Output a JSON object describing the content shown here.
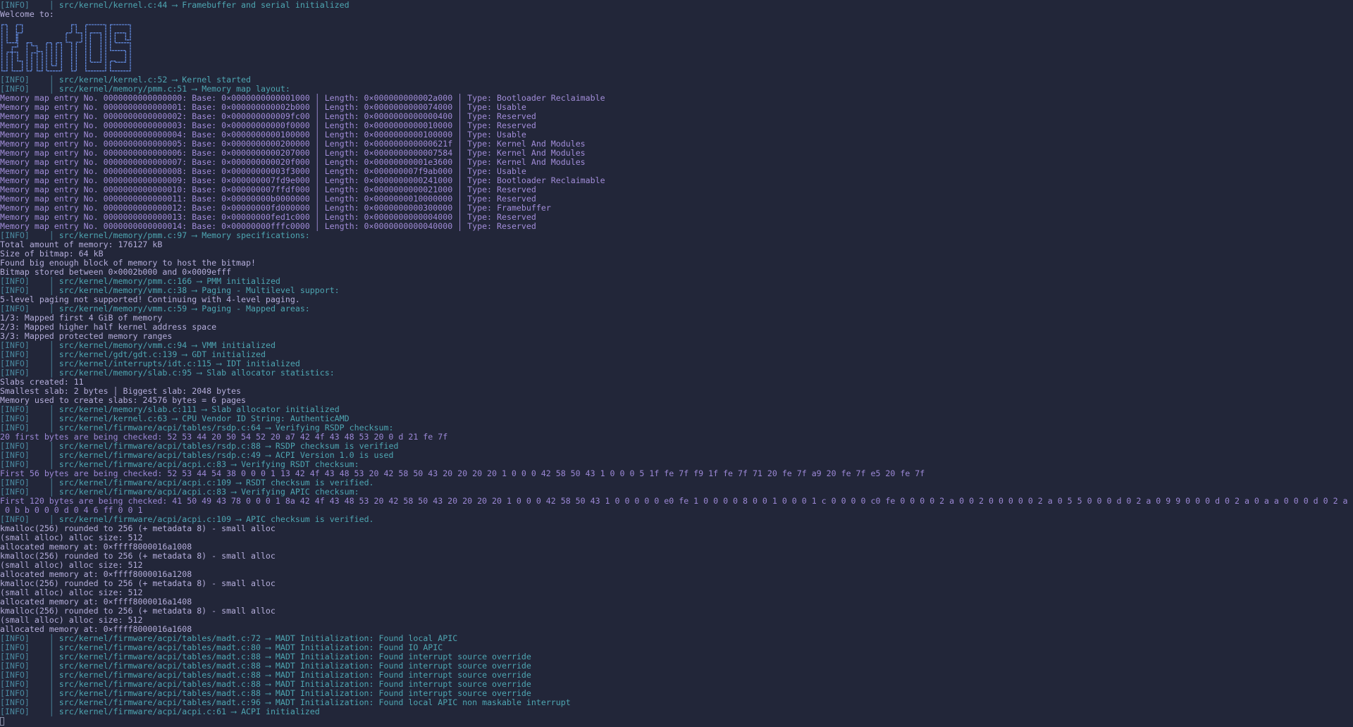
{
  "terminal": {
    "logo_text": "KnutOS",
    "info_bar": "│",
    "arrow": "⟶",
    "memmap_labels": {
      "entry": "Memory map entry No.",
      "base": "Base:",
      "length": "Length:",
      "type": "Type:",
      "separator": "│"
    },
    "lines": [
      {
        "type": "info",
        "level": "[INFO]",
        "source": "src/kernel/kernel.c:44",
        "message": "Framebuffer and serial initialized"
      },
      {
        "type": "text",
        "text": "Welcome to:"
      },
      {
        "type": "logo"
      },
      {
        "type": "info",
        "level": "[INFO]",
        "source": "src/kernel/kernel.c:52",
        "message": "Kernel started"
      },
      {
        "type": "info",
        "level": "[INFO]",
        "source": "src/kernel/memory/pmm.c:51",
        "message": "Memory map layout:"
      },
      {
        "type": "memmap",
        "entry": "0000000000000000",
        "base": "0×0000000000001000",
        "length": "0×000000000002a000",
        "mtype": "Bootloader Reclaimable"
      },
      {
        "type": "memmap",
        "entry": "0000000000000001",
        "base": "0×000000000002b000",
        "length": "0×0000000000074000",
        "mtype": "Usable"
      },
      {
        "type": "memmap",
        "entry": "0000000000000002",
        "base": "0×000000000009fc00",
        "length": "0×0000000000000400",
        "mtype": "Reserved"
      },
      {
        "type": "memmap",
        "entry": "0000000000000003",
        "base": "0×00000000000f0000",
        "length": "0×0000000000010000",
        "mtype": "Reserved"
      },
      {
        "type": "memmap",
        "entry": "0000000000000004",
        "base": "0×0000000000100000",
        "length": "0×0000000000100000",
        "mtype": "Usable"
      },
      {
        "type": "memmap",
        "entry": "0000000000000005",
        "base": "0×0000000000200000",
        "length": "0×000000000000621f",
        "mtype": "Kernel And Modules"
      },
      {
        "type": "memmap",
        "entry": "0000000000000006",
        "base": "0×0000000000207000",
        "length": "0×0000000000007584",
        "mtype": "Kernel And Modules"
      },
      {
        "type": "memmap",
        "entry": "0000000000000007",
        "base": "0×000000000020f000",
        "length": "0×00000000001e3600",
        "mtype": "Kernel And Modules"
      },
      {
        "type": "memmap",
        "entry": "0000000000000008",
        "base": "0×00000000003f3000",
        "length": "0×000000007f9ab000",
        "mtype": "Usable"
      },
      {
        "type": "memmap",
        "entry": "0000000000000009",
        "base": "0×000000007fd9e000",
        "length": "0×0000000000241000",
        "mtype": "Bootloader Reclaimable"
      },
      {
        "type": "memmap",
        "entry": "0000000000000010",
        "base": "0×000000007ffdf000",
        "length": "0×0000000000021000",
        "mtype": "Reserved"
      },
      {
        "type": "memmap",
        "entry": "0000000000000011",
        "base": "0×00000000b0000000",
        "length": "0×0000000010000000",
        "mtype": "Reserved"
      },
      {
        "type": "memmap",
        "entry": "0000000000000012",
        "base": "0×00000000fd000000",
        "length": "0×0000000000300000",
        "mtype": "Framebuffer"
      },
      {
        "type": "memmap",
        "entry": "0000000000000013",
        "base": "0×00000000fed1c000",
        "length": "0×0000000000004000",
        "mtype": "Reserved"
      },
      {
        "type": "memmap",
        "entry": "0000000000000014",
        "base": "0×00000000fffc0000",
        "length": "0×0000000000040000",
        "mtype": "Reserved"
      },
      {
        "type": "info",
        "level": "[INFO]",
        "source": "src/kernel/memory/pmm.c:97",
        "message": "Memory specifications:"
      },
      {
        "type": "text",
        "text": "Total amount of memory: 176127 kB"
      },
      {
        "type": "text",
        "text": "Size of bitmap: 64 kB"
      },
      {
        "type": "text",
        "text": "Found big enough block of memory to host the bitmap!"
      },
      {
        "type": "text",
        "text": "Bitmap stored between 0×0002b000 and 0×0009efff"
      },
      {
        "type": "info",
        "level": "[INFO]",
        "source": "src/kernel/memory/pmm.c:166",
        "message": "PMM initialized"
      },
      {
        "type": "info",
        "level": "[INFO]",
        "source": "src/kernel/memory/vmm.c:38",
        "message": "Paging - Multilevel support:"
      },
      {
        "type": "text",
        "text": "5-level paging not supported! Continuing with 4-level paging."
      },
      {
        "type": "info",
        "level": "[INFO]",
        "source": "src/kernel/memory/vmm.c:59",
        "message": "Paging - Mapped areas:"
      },
      {
        "type": "text",
        "text": "1/3: Mapped first 4 GiB of memory"
      },
      {
        "type": "text",
        "text": "2/3: Mapped higher half kernel address space"
      },
      {
        "type": "text",
        "text": "3/3: Mapped protected memory ranges"
      },
      {
        "type": "info",
        "level": "[INFO]",
        "source": "src/kernel/memory/vmm.c:94",
        "message": "VMM initialized"
      },
      {
        "type": "info",
        "level": "[INFO]",
        "source": "src/kernel/gdt/gdt.c:139",
        "message": "GDT initialized"
      },
      {
        "type": "info",
        "level": "[INFO]",
        "source": "src/kernel/interrupts/idt.c:115",
        "message": "IDT initialized"
      },
      {
        "type": "info",
        "level": "[INFO]",
        "source": "src/kernel/memory/slab.c:95",
        "message": "Slab allocator statistics:"
      },
      {
        "type": "text",
        "text": "Slabs created: 11"
      },
      {
        "type": "text",
        "text": "Smallest slab: 2 bytes │ Biggest slab: 2048 bytes"
      },
      {
        "type": "text",
        "text": "Memory used to create slabs: 24576 bytes = 6 pages"
      },
      {
        "type": "info",
        "level": "[INFO]",
        "source": "src/kernel/memory/slab.c:111",
        "message": "Slab allocator initialized"
      },
      {
        "type": "info",
        "level": "[INFO]",
        "source": "src/kernel/kernel.c:63",
        "message": "CPU Vendor ID String: AuthenticAMD"
      },
      {
        "type": "info",
        "level": "[INFO]",
        "source": "src/kernel/firmware/acpi/tables/rsdp.c:64",
        "message": "Verifying RSDP checksum:"
      },
      {
        "type": "hex",
        "text": "20 first bytes are being checked: 52 53 44 20 50 54 52 20 a7 42 4f 43 48 53 20 0 d 21 fe 7f"
      },
      {
        "type": "info",
        "level": "[INFO]",
        "source": "src/kernel/firmware/acpi/tables/rsdp.c:88",
        "message": "RSDP checksum is verified"
      },
      {
        "type": "info",
        "level": "[INFO]",
        "source": "src/kernel/firmware/acpi/tables/rsdp.c:49",
        "message": "ACPI Version 1.0 is used"
      },
      {
        "type": "info",
        "level": "[INFO]",
        "source": "src/kernel/firmware/acpi/acpi.c:83",
        "message": "Verifying RSDT checksum:"
      },
      {
        "type": "hex",
        "text": "First 56 bytes are being checked: 52 53 44 54 38 0 0 0 1 13 42 4f 43 48 53 20 42 58 50 43 20 20 20 20 1 0 0 0 42 58 50 43 1 0 0 0 5 1f fe 7f f9 1f fe 7f 71 20 fe 7f a9 20 fe 7f e5 20 fe 7f"
      },
      {
        "type": "info",
        "level": "[INFO]",
        "source": "src/kernel/firmware/acpi/acpi.c:109",
        "message": "RSDT checksum is verified."
      },
      {
        "type": "info",
        "level": "[INFO]",
        "source": "src/kernel/firmware/acpi/acpi.c:83",
        "message": "Verifying APIC checksum:"
      },
      {
        "type": "hex",
        "text": "First 120 bytes are being checked: 41 50 49 43 78 0 0 0 1 8a 42 4f 43 48 53 20 42 58 50 43 20 20 20 20 1 0 0 0 42 58 50 43 1 0 0 0 0 0 e0 fe 1 0 0 0 0 8 0 0 1 0 0 0 1 c 0 0 0 0 c0 fe 0 0 0 0 2 a 0 0 2 0 0 0 0 0 2 a 0 5 5 0 0 0 d 0 2 a 0 9 9 0 0 0 d 0 2 a 0 a a 0 0 0 d 0 2 a"
      },
      {
        "type": "hex",
        "text": " 0 b b 0 0 0 d 0 4 6 ff 0 0 1"
      },
      {
        "type": "info",
        "level": "[INFO]",
        "source": "src/kernel/firmware/acpi/acpi.c:109",
        "message": "APIC checksum is verified."
      },
      {
        "type": "text",
        "text": "kmalloc(256) rounded to 256 (+ metadata 8) - small alloc"
      },
      {
        "type": "text",
        "text": "(small alloc) alloc size: 512"
      },
      {
        "type": "text",
        "text": "allocated memory at: 0×ffff8000016a1008"
      },
      {
        "type": "text",
        "text": "kmalloc(256) rounded to 256 (+ metadata 8) - small alloc"
      },
      {
        "type": "text",
        "text": "(small alloc) alloc size: 512"
      },
      {
        "type": "text",
        "text": "allocated memory at: 0×ffff8000016a1208"
      },
      {
        "type": "text",
        "text": "kmalloc(256) rounded to 256 (+ metadata 8) - small alloc"
      },
      {
        "type": "text",
        "text": "(small alloc) alloc size: 512"
      },
      {
        "type": "text",
        "text": "allocated memory at: 0×ffff8000016a1408"
      },
      {
        "type": "text",
        "text": "kmalloc(256) rounded to 256 (+ metadata 8) - small alloc"
      },
      {
        "type": "text",
        "text": "(small alloc) alloc size: 512"
      },
      {
        "type": "text",
        "text": "allocated memory at: 0×ffff8000016a1608"
      },
      {
        "type": "info",
        "level": "[INFO]",
        "source": "src/kernel/firmware/acpi/tables/madt.c:72",
        "message": "MADT Initialization: Found local APIC"
      },
      {
        "type": "info",
        "level": "[INFO]",
        "source": "src/kernel/firmware/acpi/tables/madt.c:80",
        "message": "MADT Initialization: Found IO APIC"
      },
      {
        "type": "info",
        "level": "[INFO]",
        "source": "src/kernel/firmware/acpi/tables/madt.c:88",
        "message": "MADT Initialization: Found interrupt source override"
      },
      {
        "type": "info",
        "level": "[INFO]",
        "source": "src/kernel/firmware/acpi/tables/madt.c:88",
        "message": "MADT Initialization: Found interrupt source override"
      },
      {
        "type": "info",
        "level": "[INFO]",
        "source": "src/kernel/firmware/acpi/tables/madt.c:88",
        "message": "MADT Initialization: Found interrupt source override"
      },
      {
        "type": "info",
        "level": "[INFO]",
        "source": "src/kernel/firmware/acpi/tables/madt.c:88",
        "message": "MADT Initialization: Found interrupt source override"
      },
      {
        "type": "info",
        "level": "[INFO]",
        "source": "src/kernel/firmware/acpi/tables/madt.c:88",
        "message": "MADT Initialization: Found interrupt source override"
      },
      {
        "type": "info",
        "level": "[INFO]",
        "source": "src/kernel/firmware/acpi/tables/madt.c:96",
        "message": "MADT Initialization: Found local APIC non maskable interrupt"
      },
      {
        "type": "info",
        "level": "[INFO]",
        "source": "src/kernel/firmware/acpi/acpi.c:61",
        "message": "ACPI initialized"
      },
      {
        "type": "cursor"
      }
    ]
  },
  "colors": {
    "background": "#222639",
    "info_level": "#4b8aa0",
    "info_source": "#4ea6b2",
    "text": "#b5aedb",
    "memmap": "#a28dd9",
    "logo": "#5f85d6"
  }
}
